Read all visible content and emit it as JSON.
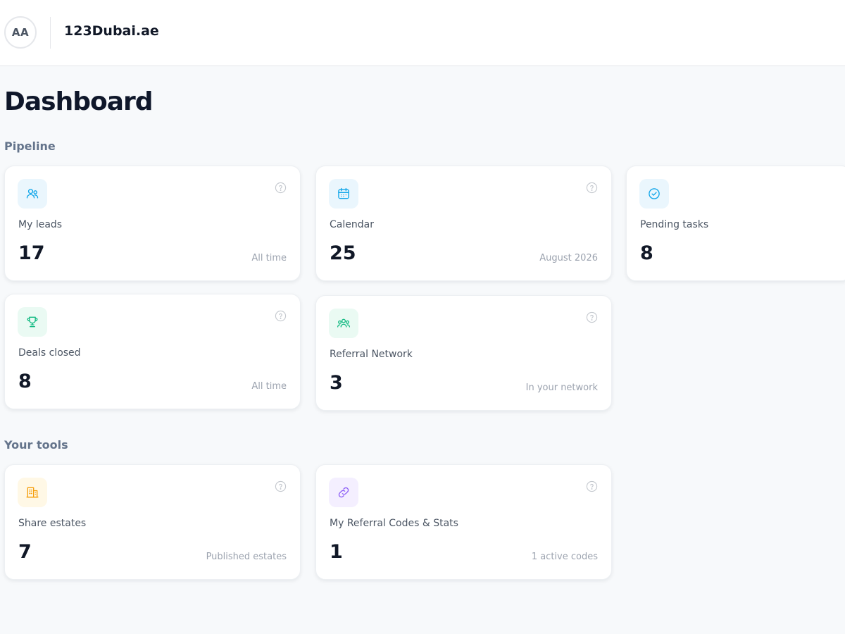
{
  "header": {
    "avatar_initials": "AA",
    "brand": "123Dubai.ae"
  },
  "page_title": "Dashboard",
  "sections": {
    "pipeline": {
      "title": "Pipeline",
      "cards": [
        {
          "label": "My leads",
          "value": "17",
          "sub": "All time",
          "icon": "users-icon",
          "icon_color": "#0ea5e9"
        },
        {
          "label": "Calendar",
          "value": "25",
          "sub": "August 2026",
          "icon": "calendar-icon",
          "icon_color": "#0ea5e9"
        },
        {
          "label": "Pending tasks",
          "value": "8",
          "sub": "",
          "icon": "check-circle-icon",
          "icon_color": "#0ea5e9"
        },
        {
          "label": "Deals closed",
          "value": "8",
          "sub": "All time",
          "icon": "trophy-icon",
          "icon_color": "#10b981"
        },
        {
          "label": "Referral Network",
          "value": "3",
          "sub": "In your network",
          "icon": "network-icon",
          "icon_color": "#10b981"
        }
      ]
    },
    "tools": {
      "title": "Your tools",
      "cards": [
        {
          "label": "Share estates",
          "value": "7",
          "sub": "Published estates",
          "icon": "building-icon",
          "icon_color": "#f59e0b"
        },
        {
          "label": "My Referral Codes & Stats",
          "value": "1",
          "sub": "1 active codes",
          "icon": "link-icon",
          "icon_color": "#8b5cf6"
        }
      ]
    }
  }
}
